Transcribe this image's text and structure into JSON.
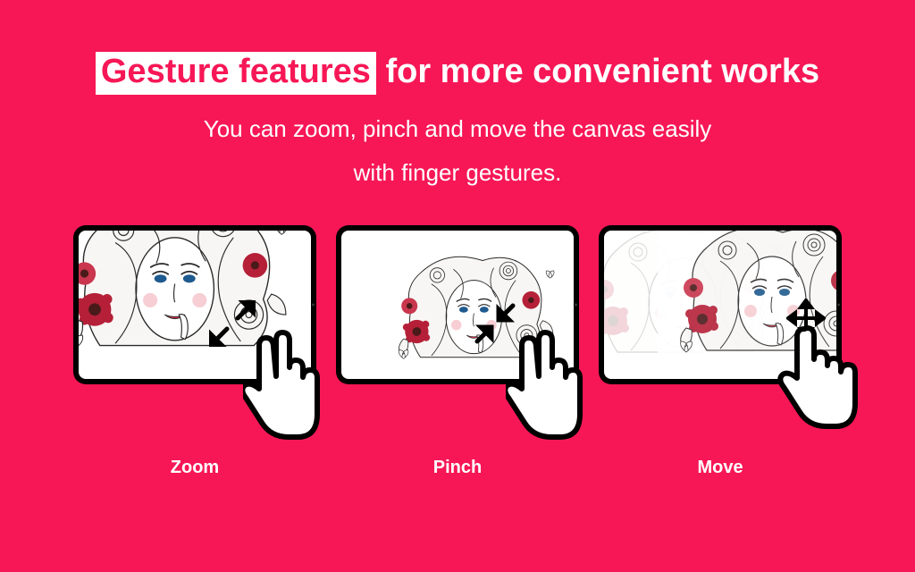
{
  "heading": {
    "highlight": "Gesture features",
    "rest": " for more convenient works"
  },
  "subtitle_line1": "You can zoom, pinch and move the canvas easily",
  "subtitle_line2": "with finger gestures.",
  "cards": [
    {
      "label": "Zoom"
    },
    {
      "label": "Pinch"
    },
    {
      "label": "Move"
    }
  ]
}
